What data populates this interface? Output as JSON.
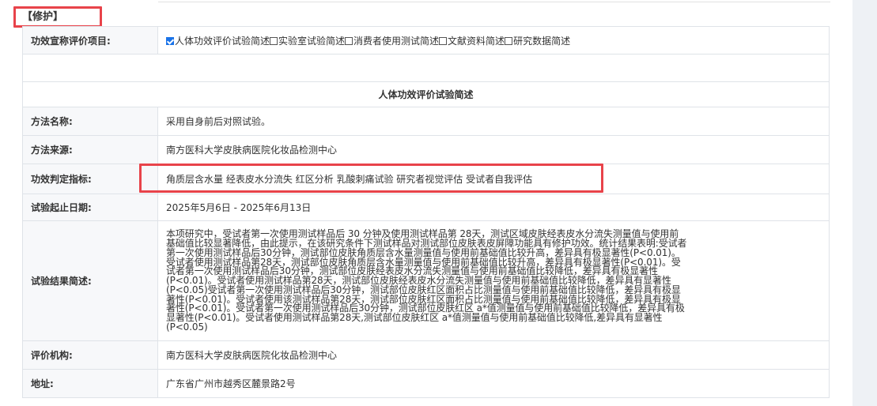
{
  "section": {
    "header": "【修护】"
  },
  "rows": {
    "claims_label": "功效宣称评价项目:",
    "claims": [
      {
        "label": "人体功效评价试验简述",
        "checked": true
      },
      {
        "label": "实验室试验简述",
        "checked": false
      },
      {
        "label": "消费者使用测试简述",
        "checked": false
      },
      {
        "label": "文献资料简述",
        "checked": false
      },
      {
        "label": "研究数据简述",
        "checked": false
      }
    ],
    "subsection_title": "人体功效评价试验简述",
    "method_name_label": "方法名称:",
    "method_name": "采用自身前后对照试验。",
    "method_source_label": "方法来源:",
    "method_source": "南方医科大学皮肤病医院化妆品检测中心",
    "criteria_label": "功效判定指标:",
    "criteria": "角质层含水量 经表皮水分流失 红区分析 乳酸刺痛试验 研究者视觉评估 受试者自我评估",
    "dates_label": "试验起止日期:",
    "dates": "2025年5月6日 - 2025年6月13日",
    "summary_label": "试验结果简述:",
    "summary": "本项研究中，受试者第一次使用测试样品后 30 分钟及使用测试样品第 28天，测试区域皮肤经表皮水分流失测量值与使用前基础值比较显著降低，由此提示，在该研究条件下测试样品对测试部位皮肤表皮屏障功能具有修护功效。统计结果表明:受试者第一次使用测试样品后30分钟，测试部位皮肤角质层含水量测量值与使用前基础值比较升高，差异具有极显著性(P<0.01)。受试者使用测试样品第28天，测试部位皮肤角质层含水量测量值与使用前基础值比较升高，差异具有极显著性(P<0.01)。受试者第一次使用测试样品后30分钟，测试部位皮肤经表皮水分流失测量值与使用前基础值比较降低，差异具有极显著性(P<0.01)。受试者使用测试样品第28天，测试部位皮肤经表皮水分流失测量值与使用前基础值比较降低，差异具有显著性(P<0.05)受试者第一次使用测试样品后30分钟，测试部位皮肤红区面积占比测量值与使用前基础值比较降低，差异具有极显著性(P<0.01)。受试者使用该测试样品第28天，测试部位皮肤红区面积占比测量值与使用前基础值比较降低，差异具有极显著性(P<0.01)。受试者第一次使用测试样品后30分钟，测试部位皮肤红区 a*值测量值与使用前基础值比较降低，差异具有极显著性(P<0.01)。受试者使用测试样品第28天,测试部位皮肤红区 a*值测量值与使用前基础值比较降低,差异具有显著性(P<0.05)",
    "institution_label": "评价机构:",
    "institution": "南方医科大学皮肤病医院化妆品检测中心",
    "address_label": "地址:",
    "address": "广东省广州市越秀区麓景路2号"
  },
  "colors": {
    "highlight": "#e8434a",
    "checkbox": "#1a73e8",
    "label_bg": "#f7f8fa"
  }
}
